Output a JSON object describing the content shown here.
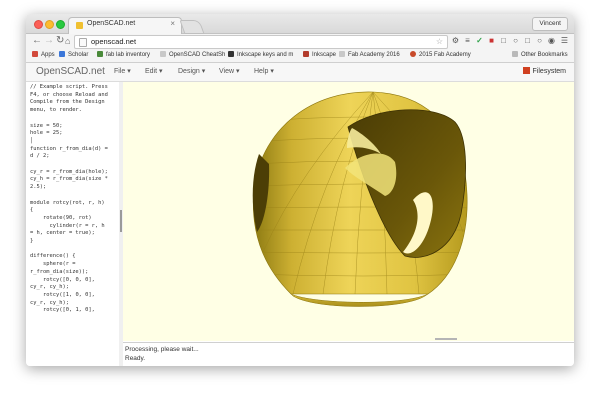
{
  "browser": {
    "tab_title": "OpenSCAD.net",
    "tab_close": "×",
    "user_name": "Vincent",
    "url": "openscad.net",
    "back_icon": "arrow-left",
    "forward_icon": "arrow-right",
    "reload_icon": "reload",
    "home_icon": "home"
  },
  "bookmarks": [
    {
      "label": "Apps",
      "color": "#d24a3c"
    },
    {
      "label": "Scholar",
      "color": "#3b77d9"
    },
    {
      "label": "fab lab inventory",
      "color": "#4a8a3a"
    },
    {
      "label": "OpenSCAD CheatSh",
      "color": "#9a9a9a"
    },
    {
      "label": "Inkscape keys and m",
      "color": "#333333"
    },
    {
      "label": "Inkscape",
      "color": "#b23c2c"
    },
    {
      "label": "Fab Academy 2016",
      "color": "#9a9a9a"
    },
    {
      "label": "2015 Fab Academy",
      "color": "#c84a2a"
    },
    {
      "label": "Other Bookmarks",
      "color": "#9a9a9a"
    }
  ],
  "app": {
    "brand": "OpenSCAD.net",
    "menus": [
      "File ▾",
      "Edit ▾",
      "Design ▾",
      "View ▾",
      "Help ▾"
    ],
    "filesystem_label": "Filesystem"
  },
  "editor": {
    "code": "// Example script. Press\nF4, or choose Reload and\nCompile from the Design\nmenu, to render.\n\nsize = 50;\nhole = 25;\n│\nfunction r_from_dia(d) =\nd / 2;\n\ncy_r = r_from_dia(hole);\ncy_h = r_from_dia(size *\n2.5);\n\nmodule rotcy(rot, r, h)\n{\n    rotate(90, rot)\n      cylinder(r = r, h\n= h, center = true);\n}\n\ndifference() {\n    sphere(r =\nr_from_dia(size));\n    rotcy([0, 0, 0],\ncy_r, cy_h);\n    rotcy([1, 0, 0],\ncy_r, cy_h);\n    rotcy([0, 1, 0],"
  },
  "console": {
    "lines": [
      "Processing, please wait...",
      "Ready."
    ]
  },
  "colors": {
    "viewport_bg": "#ffffe5",
    "model_fill": "#e3c640",
    "model_shadow": "#5a4a06"
  }
}
